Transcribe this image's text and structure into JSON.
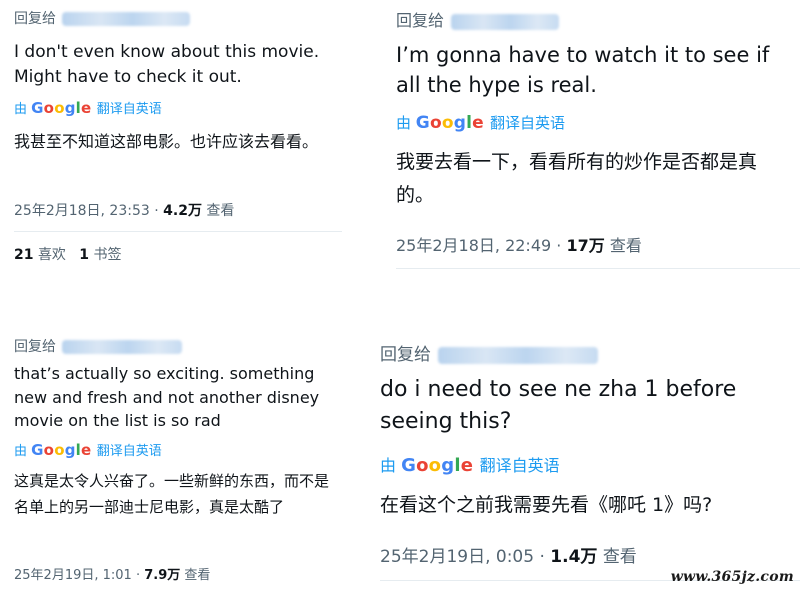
{
  "tweets": [
    {
      "reply_label": "回复给",
      "original": "I don't even know about this movie. Might have to check it out.",
      "translated_by": "由",
      "google": [
        "G",
        "o",
        "o",
        "g",
        "l",
        "e"
      ],
      "translate_label": "翻译自英语",
      "translation": "我甚至不知道这部电影。也许应该去看看。",
      "date": "25年2月18日, 23:53",
      "views": "4.2万",
      "views_label": "查看",
      "likes": "21",
      "likes_label": "喜欢",
      "bookmarks": "1",
      "bookmarks_label": "书签"
    },
    {
      "reply_label": "回复给",
      "original": "I’m gonna have to watch it to see if all the hype is real.",
      "translated_by": "由",
      "google": [
        "G",
        "o",
        "o",
        "g",
        "l",
        "e"
      ],
      "translate_label": "翻译自英语",
      "translation": "我要去看一下，看看所有的炒作是否都是真的。",
      "date": "25年2月18日, 22:49",
      "views": "17万",
      "views_label": "查看"
    },
    {
      "reply_label": "回复给",
      "original": "that’s actually so exciting. something new and fresh and not another disney movie on the list is so rad",
      "translated_by": "由",
      "google": [
        "G",
        "o",
        "o",
        "g",
        "l",
        "e"
      ],
      "translate_label": "翻译自英语",
      "translation": "这真是太令人兴奋了。一些新鲜的东西，而不是名单上的另一部迪士尼电影，真是太酷了",
      "date": "25年2月19日, 1:01",
      "views": "7.9万",
      "views_label": "查看"
    },
    {
      "reply_label": "回复给",
      "original": "do i need to see ne zha 1 before seeing this?",
      "translated_by": "由",
      "google": [
        "G",
        "o",
        "o",
        "g",
        "l",
        "e"
      ],
      "translate_label": "翻译自英语",
      "translation": "在看这个之前我需要先看《哪吒 1》吗?",
      "date": "25年2月19日, 0:05",
      "views": "1.4万",
      "views_label": "查看"
    }
  ],
  "watermark": "www.365jz.com",
  "colors": {
    "text": "#0f1419",
    "secondary": "#536471",
    "link_blue": "#1d9bf0",
    "google_blue": "#4285f4",
    "google_red": "#ea4335",
    "google_yellow": "#fbbc05",
    "google_green": "#34a853"
  }
}
